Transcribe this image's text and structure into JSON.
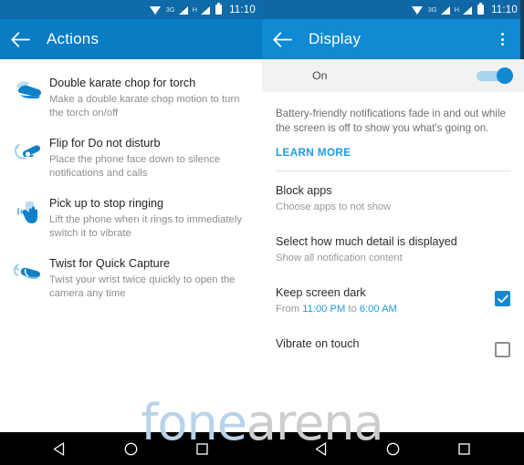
{
  "status_bar": {
    "network_label": "3G",
    "hspa_label": "H",
    "time": "11:10",
    "icons": [
      "wifi-icon",
      "signal-icon",
      "battery-icon"
    ]
  },
  "left_panel": {
    "app_bar": {
      "back_icon": "back-arrow-icon",
      "title": "Actions",
      "background": "#0a7cc4"
    },
    "actions": [
      {
        "icon": "karate-chop-hand-icon",
        "title": "Double karate chop for torch",
        "description": "Make a double karate chop motion to turn the torch on/off"
      },
      {
        "icon": "flip-phone-hand-icon",
        "title": "Flip for Do not disturb",
        "description": "Place the phone face down to silence notifications and calls"
      },
      {
        "icon": "pick-up-hand-icon",
        "title": "Pick up to stop ringing",
        "description": "Lift the phone when it rings to immediately switch it to vibrate"
      },
      {
        "icon": "twist-wrist-hand-icon",
        "title": "Twist for Quick Capture",
        "description": "Twist your wrist twice quickly to open the camera any time"
      }
    ]
  },
  "right_panel": {
    "app_bar": {
      "back_icon": "back-arrow-icon",
      "title": "Display",
      "overflow_icon": "overflow-menu-icon",
      "background": "#0f8ad3"
    },
    "toggle_row": {
      "label": "On",
      "state": "on"
    },
    "description": "Battery-friendly notifications fade in and out while the screen is off to show you what's going on.",
    "learn_more": "LEARN MORE",
    "settings": [
      {
        "title": "Block apps",
        "subtitle": "Choose apps to not show",
        "control": "none"
      },
      {
        "title": "Select how much detail is displayed",
        "subtitle": "Show all notification content",
        "control": "none"
      },
      {
        "title": "Keep screen dark",
        "subtitle_prefix": "From ",
        "subtitle_start": "11:00 PM",
        "subtitle_middle": " to ",
        "subtitle_end": "6:00 AM",
        "control": "checkbox",
        "checked": true
      },
      {
        "title": "Vibrate on touch",
        "subtitle": "",
        "control": "checkbox",
        "checked": false
      }
    ]
  },
  "nav_bar": {
    "back": "nav-back-triangle-icon",
    "home": "nav-home-circle-icon",
    "recents": "nav-recents-square-icon"
  },
  "watermark": {
    "part1": "fone",
    "part2": "arena"
  },
  "colors": {
    "accent": "#0f8ad3",
    "left_app_bar": "#0a7cc4",
    "status_bar": "#0e6aa8",
    "link": "#1f9ae0",
    "nav_bar": "#000000"
  }
}
